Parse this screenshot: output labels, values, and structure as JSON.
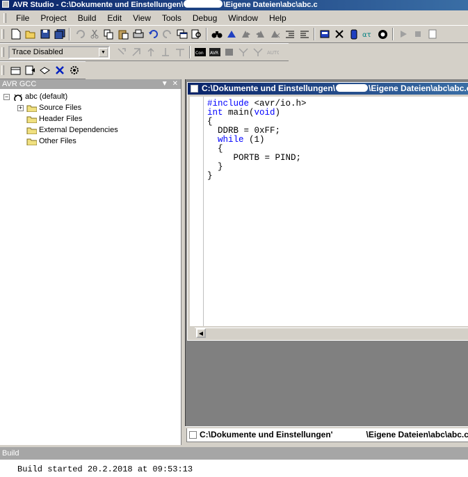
{
  "window": {
    "title_prefix": "AVR Studio - C:\\Dokumente und Einstellungen\\",
    "title_suffix": "\\Eigene Dateien\\abc\\abc.c"
  },
  "menu": [
    "File",
    "Project",
    "Build",
    "Edit",
    "View",
    "Tools",
    "Debug",
    "Window",
    "Help"
  ],
  "toolbar": {
    "trace_select": "Trace Disabled",
    "standard_icons": [
      "new-file-icon",
      "open-folder-icon",
      "save-icon",
      "save-all-icon",
      "undo-disabled-icon",
      "cut-icon",
      "copy-icon",
      "paste-icon",
      "print-icon",
      "undo-icon",
      "redo-icon",
      "window-icon",
      "find-in-files-icon",
      "binoculars-icon",
      "bookmark-icon",
      "bookmark-next-icon",
      "bookmark-prev-icon",
      "bookmark-clear-icon",
      "indent-icon",
      "outdent-icon",
      "chip-icon",
      "tools-icon",
      "jtag-icon",
      "stk-icon",
      "avr-icon",
      "play-icon",
      "stop-icon",
      "doc-icon"
    ],
    "debug_icons": [
      "step-into-icon",
      "step-over-icon",
      "step-out-icon",
      "run-to-cursor-icon",
      "breakpoint-icon",
      "con-icon",
      "avr-icon",
      "chip-icon",
      "trace-icon",
      "trace-filter-icon",
      "auto-icon"
    ],
    "build_icons": [
      "build-icon",
      "rebuild-icon",
      "compile-icon",
      "clean-icon",
      "options-icon"
    ]
  },
  "project_panel": {
    "title": "AVR GCC",
    "root_label": "abc (default)",
    "folders": [
      {
        "label": "Source Files",
        "expandable": true
      },
      {
        "label": "Header Files",
        "expandable": false
      },
      {
        "label": "External Dependencies",
        "expandable": false
      },
      {
        "label": "Other Files",
        "expandable": false
      }
    ]
  },
  "editor": {
    "title_prefix": "C:\\Dokumente und Einstellungen\\",
    "title_suffix": "\\Eigene Dateien\\abc\\abc.c",
    "tab_prefix": "C:\\Dokumente und Einstellungen'",
    "tab_suffix": "\\Eigene Dateien\\abc\\abc.c",
    "code": {
      "l1_kw": "#include",
      "l1_rest": " <avr/io.h>",
      "l2_kw": "int",
      "l2_mid": " main(",
      "l2_kw2": "void",
      "l2_end": ")",
      "l3": "{",
      "l4": "  DDRB = 0xFF;",
      "l5_pre": "  ",
      "l5_kw": "while",
      "l5_rest": " (1)",
      "l6": "  {",
      "l7": "     PORTB = PIND;",
      "l8": "  }",
      "l9": "}"
    }
  },
  "build": {
    "title": "Build",
    "output_line": "Build started 20.2.2018 at 09:53:13"
  },
  "colors": {
    "titlebar_start": "#0a246a",
    "titlebar_end": "#3a6ea5",
    "keyword": "#0000ff",
    "panel_header": "#a6a6a6",
    "chrome": "#d4d0c8"
  }
}
